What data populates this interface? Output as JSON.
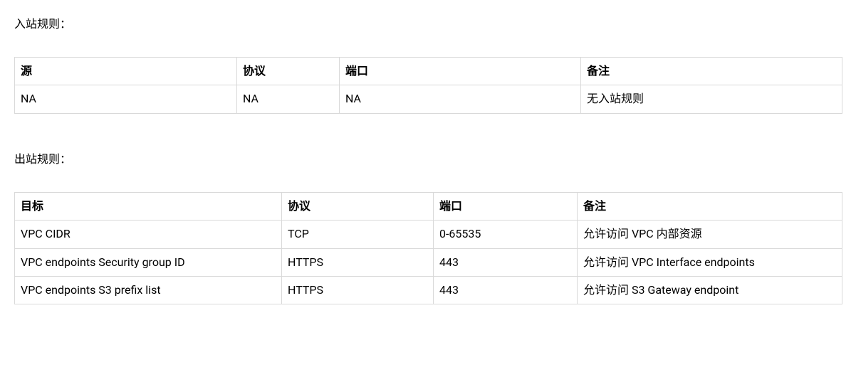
{
  "inbound": {
    "title": "入站规则：",
    "headers": {
      "source": "源",
      "protocol": "协议",
      "port": "端口",
      "comment": "备注"
    },
    "rows": [
      {
        "source": "NA",
        "protocol": "NA",
        "port": "NA",
        "comment": "无入站规则"
      }
    ]
  },
  "outbound": {
    "title": "出站规则：",
    "headers": {
      "target": "目标",
      "protocol": "协议",
      "port": "端口",
      "comment": "备注"
    },
    "rows": [
      {
        "target": "VPC CIDR",
        "protocol": "TCP",
        "port": "0-65535",
        "comment": "允许访问 VPC 内部资源"
      },
      {
        "target": "VPC endpoints Security group ID",
        "protocol": "HTTPS",
        "port": "443",
        "comment": "允许访问 VPC Interface endpoints"
      },
      {
        "target": "VPC endpoints S3 prefix list",
        "protocol": "HTTPS",
        "port": "443",
        "comment": "允许访问 S3 Gateway endpoint"
      }
    ]
  }
}
